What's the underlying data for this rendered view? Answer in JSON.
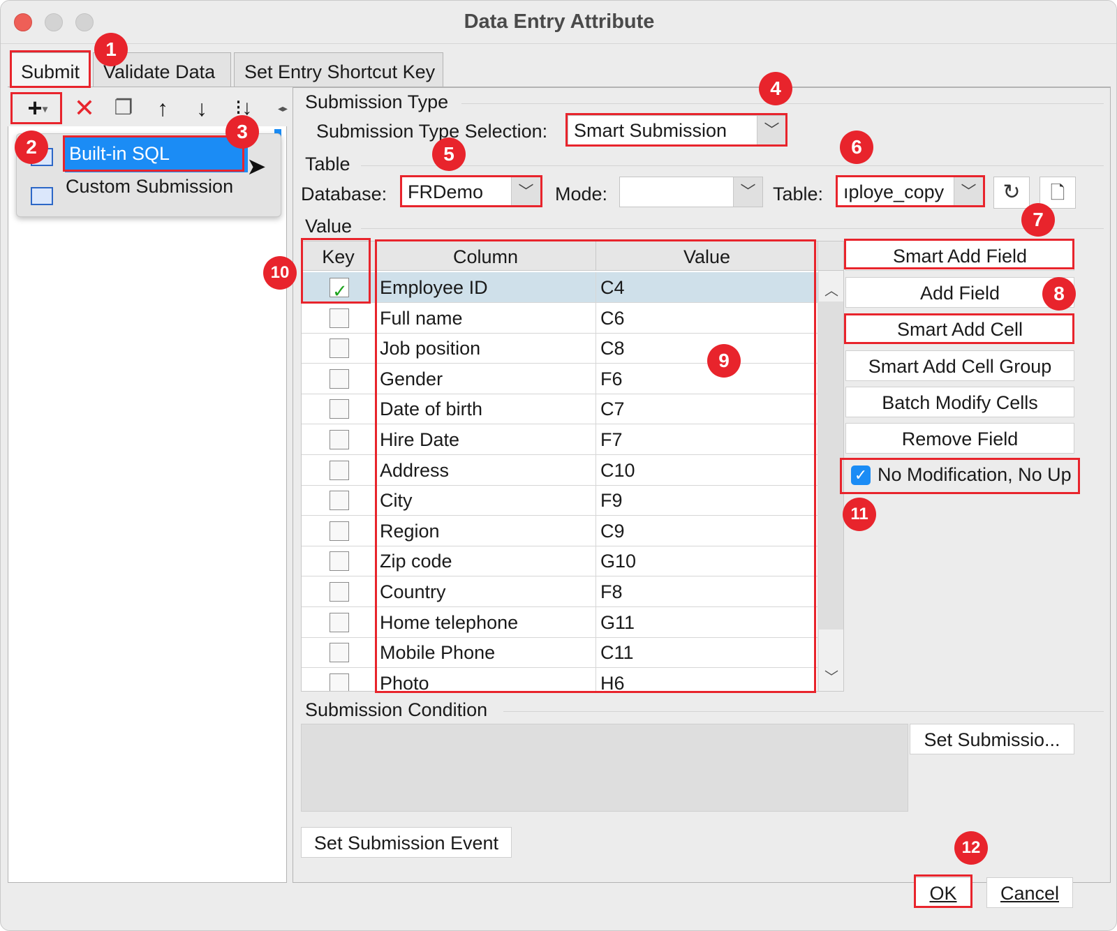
{
  "window": {
    "title": "Data Entry Attribute"
  },
  "tabs": [
    {
      "label": "Submit"
    },
    {
      "label": "Validate Data"
    },
    {
      "label": "Set Entry Shortcut Key"
    }
  ],
  "left": {
    "menu_items": [
      {
        "label": "Built-in SQL",
        "selected": true
      },
      {
        "label": "Custom Submission"
      }
    ],
    "toolbar_icons": [
      "add-icon",
      "delete-icon",
      "copy-icon",
      "move-up-icon",
      "move-down-icon",
      "sort-icon"
    ]
  },
  "submission_type": {
    "section": "Submission Type",
    "label": "Submission Type Selection:",
    "value": "Smart Submission"
  },
  "table_section": {
    "section": "Table",
    "database_label": "Database:",
    "database_value": "FRDemo",
    "mode_label": "Mode:",
    "mode_value": "",
    "table_label": "Table:",
    "table_value": "ıploye_copy"
  },
  "value_section": {
    "section": "Value",
    "headers": {
      "key": "Key",
      "column": "Column",
      "value": "Value"
    },
    "rows": [
      {
        "key": true,
        "column": "Employee ID",
        "value": "C4"
      },
      {
        "key": false,
        "column": "Full name",
        "value": "C6"
      },
      {
        "key": false,
        "column": "Job position",
        "value": "C8"
      },
      {
        "key": false,
        "column": "Gender",
        "value": "F6"
      },
      {
        "key": false,
        "column": "Date of birth",
        "value": "C7"
      },
      {
        "key": false,
        "column": "Hire Date",
        "value": "F7"
      },
      {
        "key": false,
        "column": "Address",
        "value": "C10"
      },
      {
        "key": false,
        "column": "City",
        "value": "F9"
      },
      {
        "key": false,
        "column": "Region",
        "value": "C9"
      },
      {
        "key": false,
        "column": "Zip code",
        "value": "G10"
      },
      {
        "key": false,
        "column": "Country",
        "value": "F8"
      },
      {
        "key": false,
        "column": "Home telephone",
        "value": "G11"
      },
      {
        "key": false,
        "column": "Mobile Phone",
        "value": "C11"
      },
      {
        "key": false,
        "column": "Photo",
        "value": "H6"
      }
    ]
  },
  "side_buttons": {
    "smart_add_field": "Smart Add Field",
    "add_field": "Add Field",
    "smart_add_cell": "Smart Add Cell",
    "smart_add_cell_group": "Smart Add Cell Group",
    "batch_modify_cells": "Batch Modify Cells",
    "remove_field": "Remove Field",
    "no_modification_label": "No Modification, No Up",
    "no_modification_checked": true
  },
  "condition": {
    "section": "Submission Condition",
    "set_button": "Set Submissio..."
  },
  "event_button": "Set Submission Event",
  "footer": {
    "ok": "OK",
    "cancel": "Cancel"
  },
  "annotations": [
    "1",
    "2",
    "3",
    "4",
    "5",
    "6",
    "7",
    "8",
    "9",
    "10",
    "11",
    "12"
  ],
  "colors": {
    "annotation_red": "#e8242c",
    "selection_blue": "#1b8cf5",
    "row_highlight": "#cfe0ea"
  }
}
